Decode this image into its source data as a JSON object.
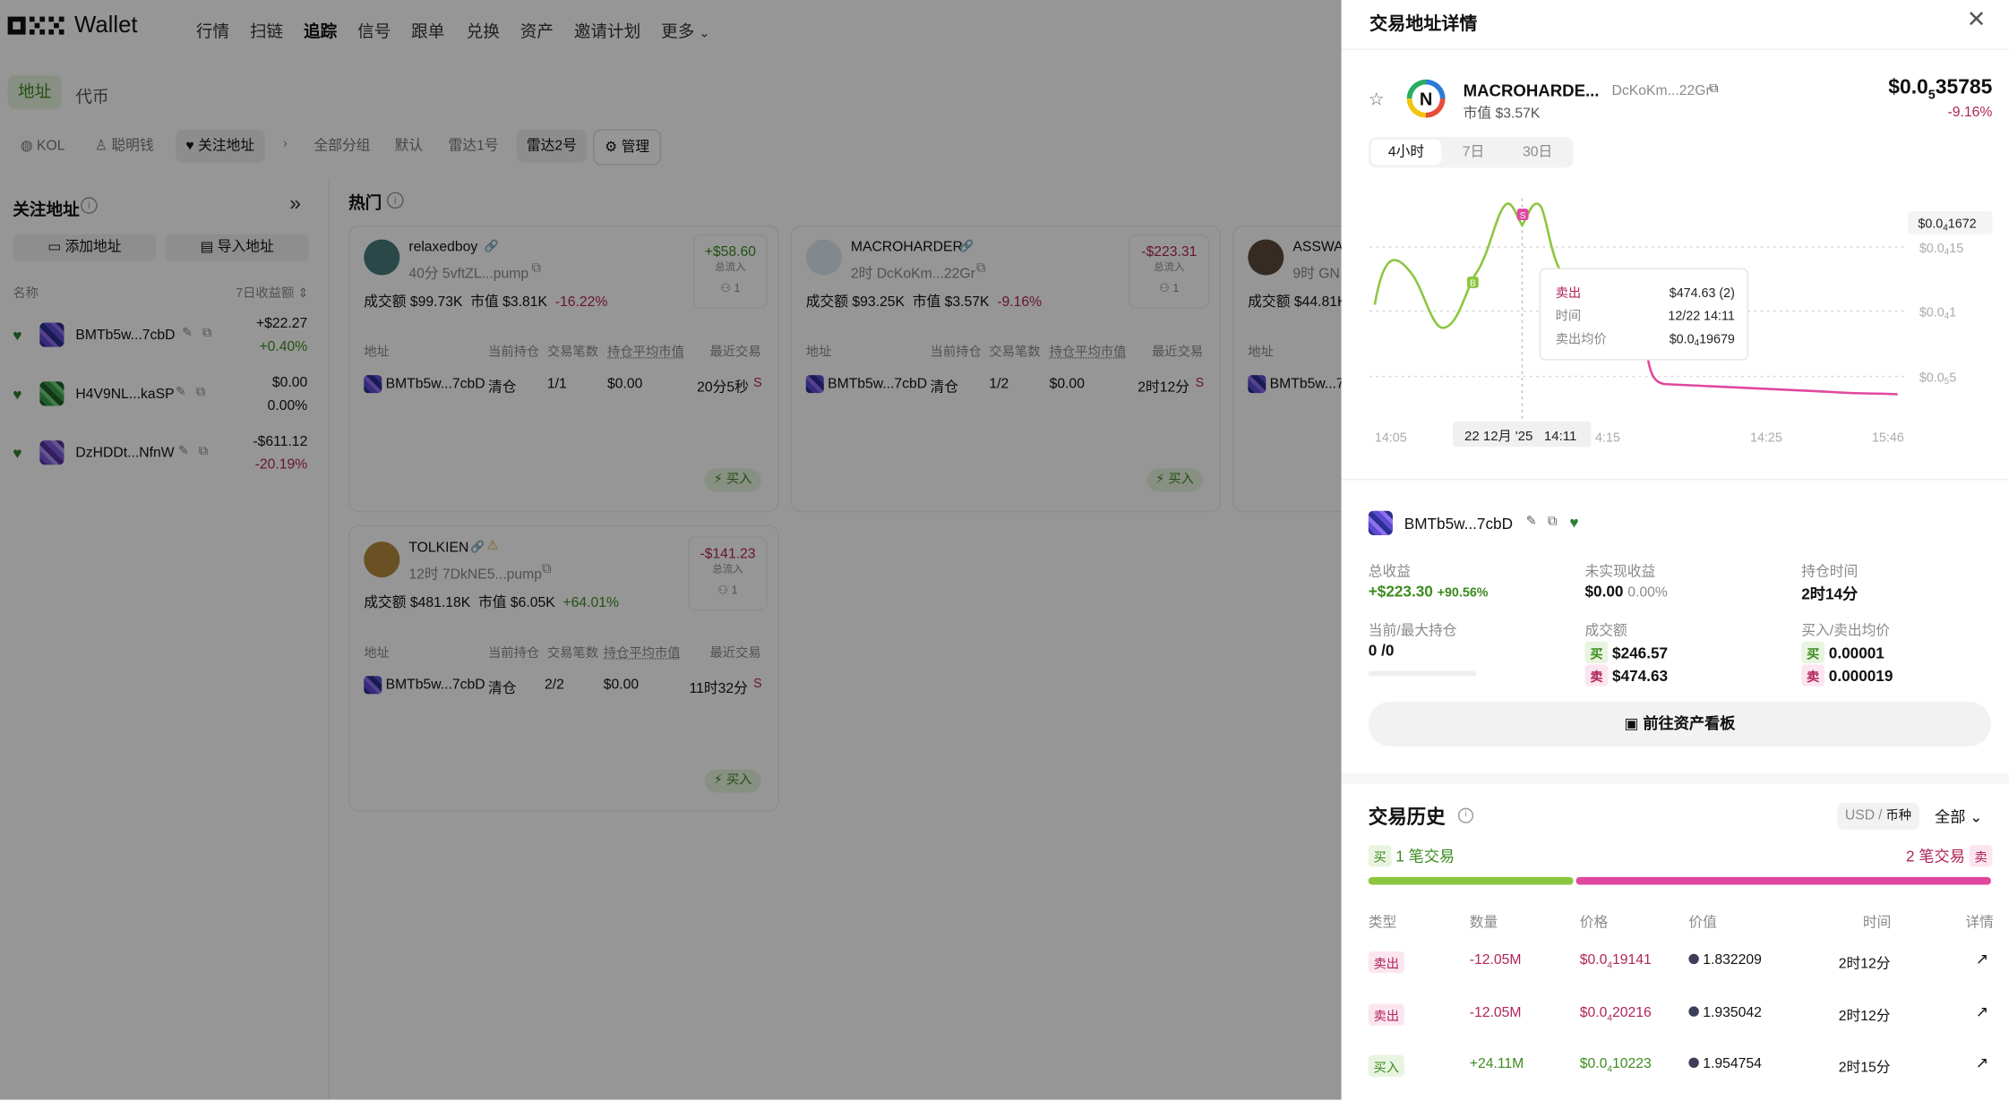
{
  "app": {
    "logo_text": "OKX",
    "wallet_label": "Wallet"
  },
  "nav": {
    "items": [
      "行情",
      "扫链",
      "追踪",
      "信号",
      "跟单",
      "兑换",
      "资产",
      "邀请计划",
      "更多"
    ]
  },
  "tabs": {
    "address": "地址",
    "token": "代币"
  },
  "filters": {
    "kol": "KOL",
    "smart": "聪明钱",
    "watched": "关注地址",
    "all_groups": "全部分组",
    "default": "默认",
    "radar1": "雷达1号",
    "radar2": "雷达2号",
    "manage": "管理"
  },
  "sidebar": {
    "title": "关注地址",
    "add_button": "添加地址",
    "import_button": "导入地址",
    "col_name": "名称",
    "col_pnl": "7日收益额",
    "items": [
      {
        "name": "BMTb5w...7cbD",
        "pnl": "+$22.27",
        "pct": "+0.40%"
      },
      {
        "name": "H4V9NL...kaSP",
        "pnl": "$0.00",
        "pct": "0.00%"
      },
      {
        "name": "DzHDDt...NfnW",
        "pnl": "-$611.12",
        "pct": "-20.19%"
      }
    ]
  },
  "hot": {
    "title": "热门",
    "cols": {
      "address": "地址",
      "holding": "当前持仓",
      "count": "交易笔数",
      "avg_mc": "持仓平均市值",
      "recent": "最近交易"
    },
    "pnl_label": "总流入",
    "buy_label": "买入",
    "cards": [
      {
        "name": "relaxedboy",
        "sub": "40分 5vftZL...pump",
        "flow": "+$58.60",
        "people": "1",
        "vol": "成交额 $99.73K",
        "mc": "市值 $3.81K",
        "chg": "-16.22%",
        "row": {
          "addr": "BMTb5w...7cbD",
          "state": "清仓",
          "count": "1/1",
          "avg": "$0.00",
          "recent": "20分5秒",
          "side": "S"
        }
      },
      {
        "name": "MACROHARDER",
        "sub": "2时 DcKoKm...22Gr",
        "flow": "-$223.31",
        "people": "1",
        "vol": "成交额 $93.25K",
        "mc": "市值 $3.57K",
        "chg": "-9.16%",
        "row": {
          "addr": "BMTb5w...7cbD",
          "state": "清仓",
          "count": "1/2",
          "avg": "$0.00",
          "recent": "2时12分",
          "side": "S"
        }
      },
      {
        "name": "ASSWAS",
        "sub": "9时 GN",
        "vol": "成交额 $44.81K",
        "row": {
          "addr": "BMTb5w...7"
        }
      },
      {
        "name": "TOLKIEN",
        "sub": "12时 7DkNE5...pump",
        "flow": "-$141.23",
        "people": "1",
        "vol": "成交额 $481.18K",
        "mc": "市值 $6.05K",
        "chg": "+64.01%",
        "row": {
          "addr": "BMTb5w...7cbD",
          "state": "清仓",
          "count": "2/2",
          "avg": "$0.00",
          "recent": "11时32分",
          "side": "S"
        }
      }
    ]
  },
  "panel": {
    "title": "交易地址详情",
    "token": {
      "name": "MACROHARDE...",
      "addr": "DcKoKm...22Gr",
      "mc": "市值 $3.57K",
      "price_main": "$0.0",
      "price_sub": "5",
      "price_rest": "35785",
      "change": "-9.16%"
    },
    "ranges": [
      "4小时",
      "7日",
      "30日"
    ],
    "chart_data": {
      "type": "line",
      "x_ticks": [
        "14:05",
        "4:15",
        "14:25",
        "15:46"
      ],
      "y_ticks": [
        {
          "main": "$0.0",
          "sub": "4",
          "rest": "15"
        },
        {
          "main": "$0.0",
          "sub": "4",
          "rest": "1"
        },
        {
          "main": "$0.0",
          "sub": "5",
          "rest": "5"
        }
      ],
      "current_price": {
        "main": "$0.0",
        "sub": "4",
        "rest": "1672"
      },
      "markers": [
        "B",
        "S"
      ],
      "crosshair_label": "22 12月 '25   14:11",
      "tooltip": {
        "side": "卖出",
        "amount": "$474.63 (2)",
        "time_label": "时间",
        "time": "12/22 14:11",
        "avg_label": "卖出均价",
        "avg_main": "$0.0",
        "avg_sub": "4",
        "avg_rest": "19679"
      },
      "colors": {
        "up": "#8cc63f",
        "down": "#e0479e"
      }
    },
    "holder": {
      "name": "BMTb5w...7cbD"
    },
    "stats": {
      "total_label": "总收益",
      "total": "+$223.30",
      "total_pct": "+90.56%",
      "unreal_label": "未实现收益",
      "unreal": "$0.00",
      "unreal_pct": "0.00%",
      "hold_label": "持仓时间",
      "hold": "2时14分",
      "pos_label": "当前/最大持仓",
      "pos": "0 /0",
      "vol_label": "成交额",
      "buy_tag": "买",
      "sell_tag": "卖",
      "vol_buy": "$246.57",
      "vol_sell": "$474.63",
      "avg_label": "买入/卖出均价",
      "avg_buy": "0.00001",
      "avg_sell": "0.000019"
    },
    "dashboard_button": "前往资产看板",
    "history": {
      "title": "交易历史",
      "currency_usd": "USD",
      "currency_sep": "/",
      "currency_coin": "币种",
      "filter": "全部",
      "buy_tag": "买",
      "buy_count": "1 笔交易",
      "sell_count": "2 笔交易",
      "sell_tag": "卖",
      "buy_ratio": 0.33,
      "cols": [
        "类型",
        "数量",
        "价格",
        "价值",
        "时间",
        "详情"
      ],
      "rows": [
        {
          "type": "卖出",
          "side": "sell",
          "qty": "-12.05M",
          "price_main": "$0.0",
          "price_sub": "4",
          "price_rest": "19141",
          "value": "1.832209",
          "time": "2时12分"
        },
        {
          "type": "卖出",
          "side": "sell",
          "qty": "-12.05M",
          "price_main": "$0.0",
          "price_sub": "4",
          "price_rest": "20216",
          "value": "1.935042",
          "time": "2时12分"
        },
        {
          "type": "买入",
          "side": "buy",
          "qty": "+24.11M",
          "price_main": "$0.0",
          "price_sub": "4",
          "price_rest": "10223",
          "value": "1.954754",
          "time": "2时15分"
        }
      ]
    }
  }
}
